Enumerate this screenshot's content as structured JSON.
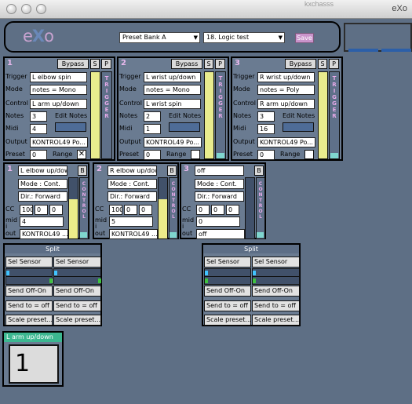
{
  "window": {
    "title": "eXo",
    "behind_title": "kxchasss"
  },
  "header": {
    "logo_e": "e",
    "logo_x": "X",
    "logo_o": "o",
    "preset_bank": "Preset Bank A",
    "preset": "18. Logic test",
    "save_label": "Save"
  },
  "triggers": [
    {
      "num": "1",
      "bypass": "Bypass",
      "s": "S",
      "p": "P",
      "trigger_label": "Trigger",
      "trigger": "L elbow spin",
      "mode_label": "Mode",
      "mode": "notes = Mono",
      "control_label": "Control",
      "control": "L arm up/down",
      "notes_label": "Notes",
      "notes": "3",
      "edit_notes": "Edit Notes",
      "midi_label": "Midi",
      "midi": "4",
      "output_label": "Output",
      "output": "KONTROL49 Po...",
      "preset_label": "Preset",
      "preset": "0",
      "range_label": "Range",
      "range_mark": "✕",
      "vertical": "TRIGGER"
    },
    {
      "num": "2",
      "bypass": "Bypass",
      "s": "S",
      "p": "P",
      "trigger_label": "Trigger",
      "trigger": "L wrist up/down",
      "mode_label": "Mode",
      "mode": "notes = Mono",
      "control_label": "Control",
      "control": "L wrist spin",
      "notes_label": "Notes",
      "notes": "2",
      "edit_notes": "Edit Notes",
      "midi_label": "Midi",
      "midi": "1",
      "output_label": "Output",
      "output": "KONTROL49 Po...",
      "preset_label": "Preset",
      "preset": "0",
      "range_label": "Range",
      "range_mark": "",
      "vertical": "TRIGGER"
    },
    {
      "num": "3",
      "bypass": "Bypass",
      "s": "S",
      "p": "P",
      "trigger_label": "Trigger",
      "trigger": "R wrist up/down",
      "mode_label": "Mode",
      "mode": "notes = Poly",
      "control_label": "Control",
      "control": "R arm up/down",
      "notes_label": "Notes",
      "notes": "3",
      "edit_notes": "Edit Notes",
      "midi_label": "Midi",
      "midi": "16",
      "output_label": "Output",
      "output": "KONTROL49 Po...",
      "preset_label": "Preset",
      "preset": "0",
      "range_label": "Range",
      "range_mark": "",
      "vertical": "TRIGGER"
    }
  ],
  "controls": [
    {
      "num": "1",
      "sensor": "L elbow up/down",
      "b": "B",
      "mode": "Mode : Cont.",
      "dir": "Dir.: Forward",
      "cc_label": "CC",
      "cc": [
        "100",
        "0",
        "0"
      ],
      "mid_label": "mid",
      "mid": "4",
      "i_label": "i",
      "out_label": "out",
      "out": "KONTROL49 ...",
      "vertical": "CONTROL"
    },
    {
      "num": "2",
      "sensor": "R elbow up/down",
      "b": "B",
      "mode": "Mode : Cont.",
      "dir": "Dir.: Forward",
      "cc_label": "CC",
      "cc": [
        "100",
        "0",
        "0"
      ],
      "mid_label": "mid",
      "mid": "5",
      "i_label": "i",
      "out_label": "out",
      "out": "KONTROL49 ...",
      "vertical": "CONTROL"
    },
    {
      "num": "3",
      "sensor": "off",
      "b": "B",
      "mode": "Mode : Cont.",
      "dir": "Dir.: Forward",
      "cc_label": "CC",
      "cc": [
        "0",
        "0",
        "0"
      ],
      "mid_label": "mid",
      "mid": "0",
      "i_label": "i",
      "out_label": "out",
      "out": "off",
      "vertical": "CONTROL"
    }
  ],
  "splits": [
    {
      "title": "Split",
      "sel_a": "Sel Sensor",
      "sel_b": "Sel Sensor",
      "send_a": "Send Off-On",
      "send_b": "Send Off-On",
      "sendto_a": "Send to = off",
      "sendto_b": "Send to = off",
      "scale_a": "Scale preset...",
      "scale_b": "Scale preset..."
    },
    {
      "title": "Split",
      "sel_a": "Sel Sensor",
      "sel_b": "Sel Sensor",
      "send_a": "Send Off-On",
      "send_b": "Send Off-On",
      "sendto_a": "Send to = off",
      "sendto_b": "Send to = off",
      "scale_a": "Scale preset...",
      "scale_b": "Scale preset..."
    }
  ],
  "preset_display": {
    "header": "L arm up/down",
    "value": "1"
  },
  "colors": {
    "background": "#5e6f85",
    "accent_pink": "#e5a9e8",
    "yellow": "#e9ec8e",
    "teal": "#7fd6cf",
    "save": "#c994cb",
    "green_header": "#3cb790"
  }
}
